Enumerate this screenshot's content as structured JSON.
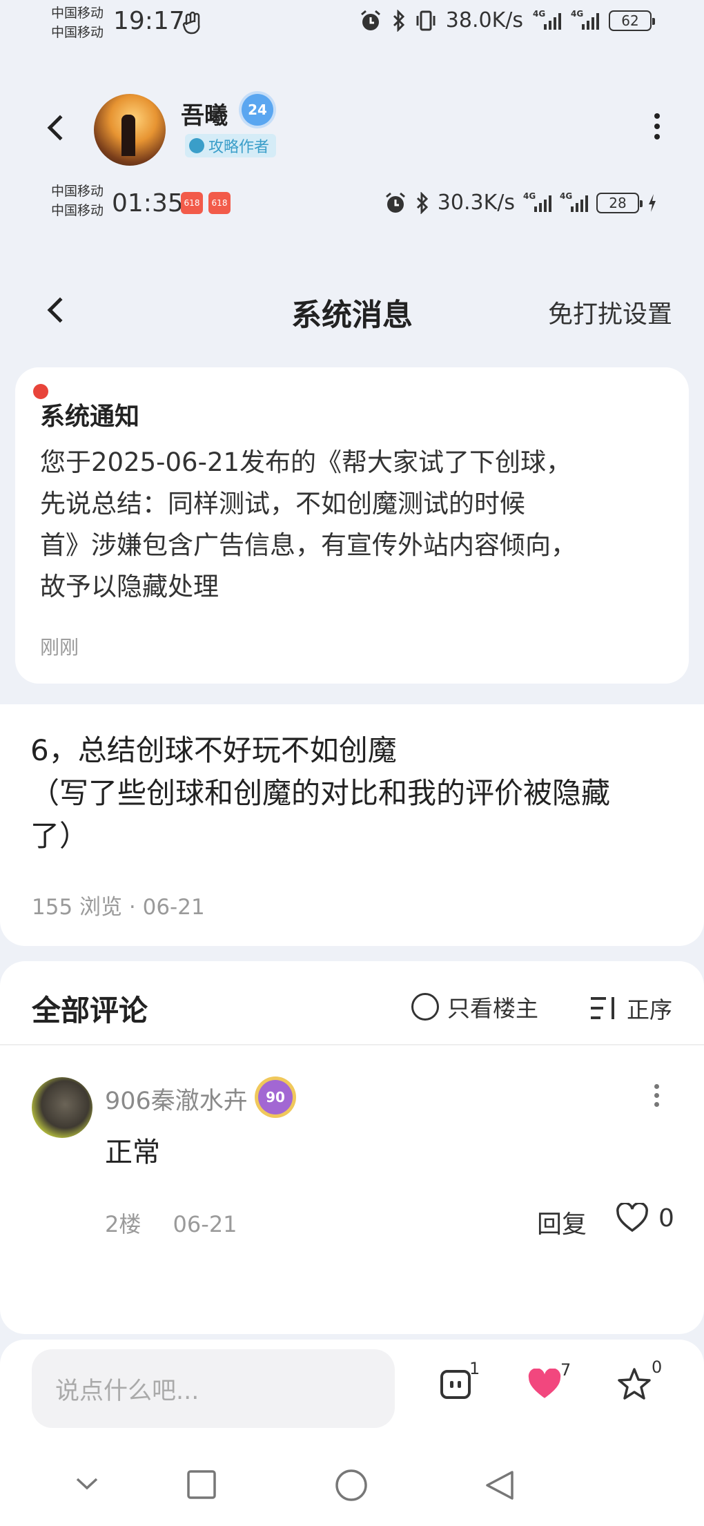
{
  "status_top": {
    "carrier1": "中国移动",
    "carrier2": "中国移动",
    "time": "19:17",
    "speed": "38.0K/s",
    "battery": "62"
  },
  "profile": {
    "name": "吾曦",
    "level": "24",
    "role": "攻略作者"
  },
  "status_second": {
    "carrier1": "中国移动",
    "carrier2": "中国移动",
    "time": "01:35",
    "speed": "30.3K/s",
    "battery": "28",
    "badge_a": "618",
    "badge_b": "618"
  },
  "page": {
    "title": "系统消息",
    "dnd_label": "免打扰设置"
  },
  "notice": {
    "title": "系统通知",
    "lines": [
      "您于2025-06-21发布的《帮大家试了下创球，",
      "先说总结：同样测试，不如创魔测试的时候",
      "首》涉嫌包含广告信息，有宣传外站内容倾向，",
      "故予以隐藏处理"
    ],
    "time": "刚刚"
  },
  "post": {
    "lines": [
      "6，总结创球不好玩不如创魔",
      "（写了些创球和创魔的对比和我的评价被隐藏",
      "了）"
    ],
    "views": "155 浏览",
    "date": "06-21"
  },
  "comments": {
    "title": "全部评论",
    "only_owner": "只看楼主",
    "order": "正序",
    "items": [
      {
        "name": "906秦澈水卉",
        "level": "90",
        "text": "正常",
        "floor": "2楼",
        "date": "06-21",
        "reply": "回复",
        "likes": "0"
      }
    ]
  },
  "actionbar": {
    "placeholder": "说点什么吧...",
    "comment_count": "1",
    "like_count": "7",
    "star_count": "0"
  },
  "colors": {
    "background": "#eef1f7",
    "red_dot": "#e8443a",
    "heart": "#f2477e",
    "role_badge": "#3a9ec9"
  }
}
